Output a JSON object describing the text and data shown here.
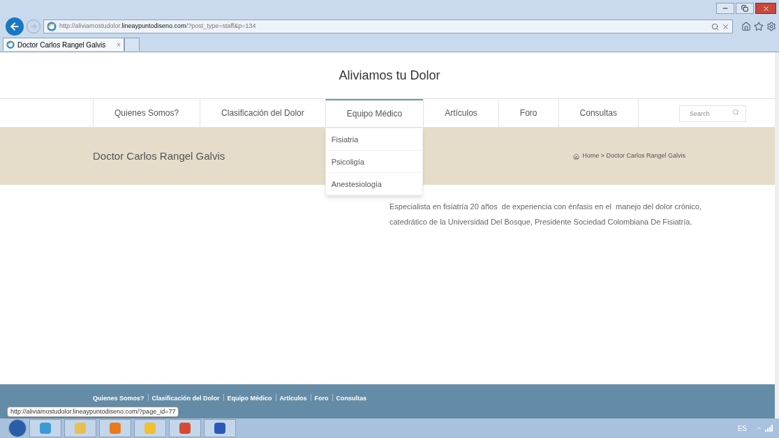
{
  "browser": {
    "url_prefix": "http://aliviamostudolor.",
    "url_domain": "lineaypuntodiseno.com",
    "url_rest": "/?post_type=staff&p=134",
    "tabs": [
      {
        "label": "Doctor Carlos Rangel Galvis",
        "close": "×",
        "selected": true
      }
    ]
  },
  "site": {
    "title": "Aliviamos tu Dolor"
  },
  "nav": [
    {
      "label": "Quienes Somos?",
      "selected": false
    },
    {
      "label": "Clasificación del Dolor",
      "selected": false
    },
    {
      "label": "Equipo Médico",
      "selected": true,
      "submenu": [
        "Fisiatria",
        "Psicoligía",
        "Anestesiología"
      ]
    },
    {
      "label": "Artículos",
      "selected": false
    },
    {
      "label": "Foro",
      "selected": false
    },
    {
      "label": "Consultas",
      "selected": false
    }
  ],
  "search": {
    "placeholder": "Search"
  },
  "banner": {
    "title": "Doctor Carlos Rangel Galvis",
    "breadcrumb": "Home > Doctor Carlos Rangel Galvis"
  },
  "content": {
    "paragraph": "Especialista en fisiatría 20 años  de experiencia con énfasis en el  manejo del dolor crónico, catedrático de la Universidad Del Bosque, Presidente Sociedad Colombiana De Fisiatría."
  },
  "footer": {
    "links": [
      "Quienes Somos?",
      "Clasificación del Dolor",
      "Equipo Médico",
      "Artículos",
      "Foro",
      "Consultas"
    ]
  },
  "status_tooltip": "http://aliviamostudolor.lineaypuntodiseno.com/?page_id=77",
  "taskbar": {
    "language": "ES"
  }
}
